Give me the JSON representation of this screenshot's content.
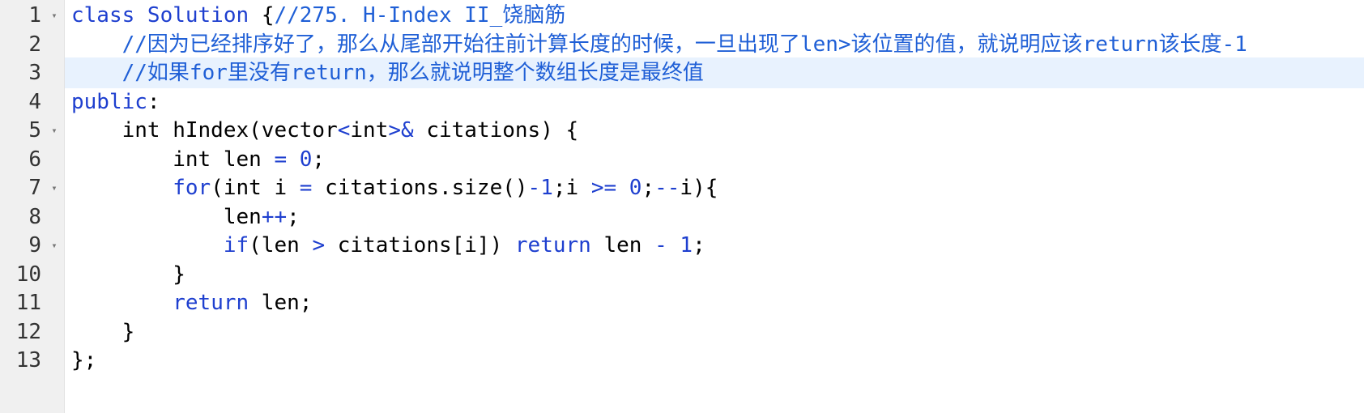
{
  "editor": {
    "fold_glyph": "▾",
    "active_line": 3,
    "lines": [
      {
        "num": "1",
        "fold": true,
        "tokens": [
          {
            "t": "kw",
            "v": "class Solution "
          },
          {
            "t": "plain",
            "v": "{"
          },
          {
            "t": "cm",
            "v": "//275. H-Index II_饶脑筋"
          }
        ]
      },
      {
        "num": "2",
        "fold": false,
        "tokens": [
          {
            "t": "plain",
            "v": "    "
          },
          {
            "t": "cm",
            "v": "//因为已经排序好了，那么从尾部开始往前计算长度的时候，一旦出现了len>该位置的值，就说明应该return该长度-1"
          }
        ]
      },
      {
        "num": "3",
        "fold": false,
        "tokens": [
          {
            "t": "plain",
            "v": "    "
          },
          {
            "t": "cm",
            "v": "//如果for里没有return，那么就说明整个数组长度是最终值"
          }
        ]
      },
      {
        "num": "4",
        "fold": false,
        "tokens": [
          {
            "t": "kw",
            "v": "public"
          },
          {
            "t": "plain",
            "v": ":"
          }
        ]
      },
      {
        "num": "5",
        "fold": true,
        "tokens": [
          {
            "t": "plain",
            "v": "    int hIndex(vector"
          },
          {
            "t": "op",
            "v": "<"
          },
          {
            "t": "plain",
            "v": "int"
          },
          {
            "t": "op",
            "v": ">&"
          },
          {
            "t": "plain",
            "v": " citations) {"
          }
        ]
      },
      {
        "num": "6",
        "fold": false,
        "tokens": [
          {
            "t": "plain",
            "v": "        int len "
          },
          {
            "t": "op",
            "v": "="
          },
          {
            "t": "plain",
            "v": " "
          },
          {
            "t": "num",
            "v": "0"
          },
          {
            "t": "plain",
            "v": ";"
          }
        ]
      },
      {
        "num": "7",
        "fold": true,
        "tokens": [
          {
            "t": "plain",
            "v": "        "
          },
          {
            "t": "kw",
            "v": "for"
          },
          {
            "t": "plain",
            "v": "(int i "
          },
          {
            "t": "op",
            "v": "="
          },
          {
            "t": "plain",
            "v": " citations.size()"
          },
          {
            "t": "op",
            "v": "-"
          },
          {
            "t": "num",
            "v": "1"
          },
          {
            "t": "plain",
            "v": ";i "
          },
          {
            "t": "op",
            "v": ">="
          },
          {
            "t": "plain",
            "v": " "
          },
          {
            "t": "num",
            "v": "0"
          },
          {
            "t": "plain",
            "v": ";"
          },
          {
            "t": "op",
            "v": "--"
          },
          {
            "t": "plain",
            "v": "i){"
          }
        ]
      },
      {
        "num": "8",
        "fold": false,
        "tokens": [
          {
            "t": "plain",
            "v": "            len"
          },
          {
            "t": "op",
            "v": "++"
          },
          {
            "t": "plain",
            "v": ";"
          }
        ]
      },
      {
        "num": "9",
        "fold": true,
        "tokens": [
          {
            "t": "plain",
            "v": "            "
          },
          {
            "t": "kw",
            "v": "if"
          },
          {
            "t": "plain",
            "v": "(len "
          },
          {
            "t": "op",
            "v": ">"
          },
          {
            "t": "plain",
            "v": " citations[i]) "
          },
          {
            "t": "kw",
            "v": "return"
          },
          {
            "t": "plain",
            "v": " len "
          },
          {
            "t": "op",
            "v": "-"
          },
          {
            "t": "plain",
            "v": " "
          },
          {
            "t": "num",
            "v": "1"
          },
          {
            "t": "plain",
            "v": ";"
          }
        ]
      },
      {
        "num": "10",
        "fold": false,
        "tokens": [
          {
            "t": "plain",
            "v": "        }"
          }
        ]
      },
      {
        "num": "11",
        "fold": false,
        "tokens": [
          {
            "t": "plain",
            "v": "        "
          },
          {
            "t": "kw",
            "v": "return"
          },
          {
            "t": "plain",
            "v": " len;"
          }
        ]
      },
      {
        "num": "12",
        "fold": false,
        "tokens": [
          {
            "t": "plain",
            "v": "    }"
          }
        ]
      },
      {
        "num": "13",
        "fold": false,
        "tokens": [
          {
            "t": "plain",
            "v": "};"
          }
        ]
      }
    ]
  },
  "colors": {
    "keyword": "#1e3fcf",
    "comment": "#1f5fd6",
    "active_line_bg": "#e8f2fe",
    "gutter_bg": "#f0f0f0"
  }
}
